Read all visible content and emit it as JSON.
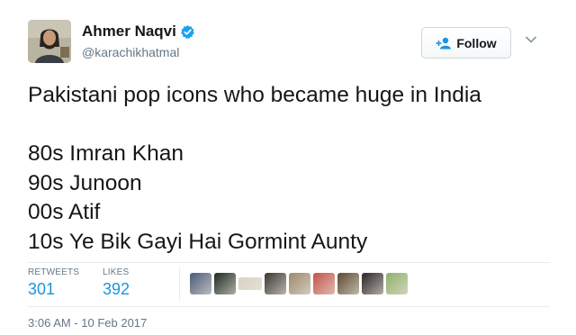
{
  "author": {
    "name": "Ahmer Naqvi",
    "handle": "@karachikhatmal",
    "verified": true,
    "avatar_icon": "profile-photo"
  },
  "follow_button": {
    "label": "Follow",
    "icon": "user-plus-icon"
  },
  "menu_icon": "chevron-down-icon",
  "tweet": {
    "lines": [
      "Pakistani pop icons who became huge in India",
      "",
      "80s Imran Khan",
      "90s Junoon",
      "00s Atif",
      "10s Ye Bik Gayi Hai Gormint Aunty"
    ]
  },
  "stats": {
    "retweets_label": "RETWEETS",
    "retweets": "301",
    "likes_label": "LIKES",
    "likes": "392"
  },
  "likers": [
    {
      "name": "liker-avatar-1",
      "color": "#4a5a78"
    },
    {
      "name": "liker-avatar-2",
      "color": "#1d2a1f"
    },
    {
      "name": "liker-avatar-3",
      "color": "#d9d2c4"
    },
    {
      "name": "liker-avatar-4",
      "color": "#3a3733"
    },
    {
      "name": "liker-avatar-5",
      "color": "#9b8a6c"
    },
    {
      "name": "liker-avatar-6",
      "color": "#c4524a"
    },
    {
      "name": "liker-avatar-7",
      "color": "#5b4a2f"
    },
    {
      "name": "liker-avatar-8",
      "color": "#2a2424"
    },
    {
      "name": "liker-avatar-9",
      "color": "#8fb06a"
    }
  ],
  "timestamp": "3:06 AM - 10 Feb 2017",
  "colors": {
    "accent": "#1b95e0",
    "verified": "#1da1f2",
    "text": "#14171a",
    "muted": "#657786"
  }
}
